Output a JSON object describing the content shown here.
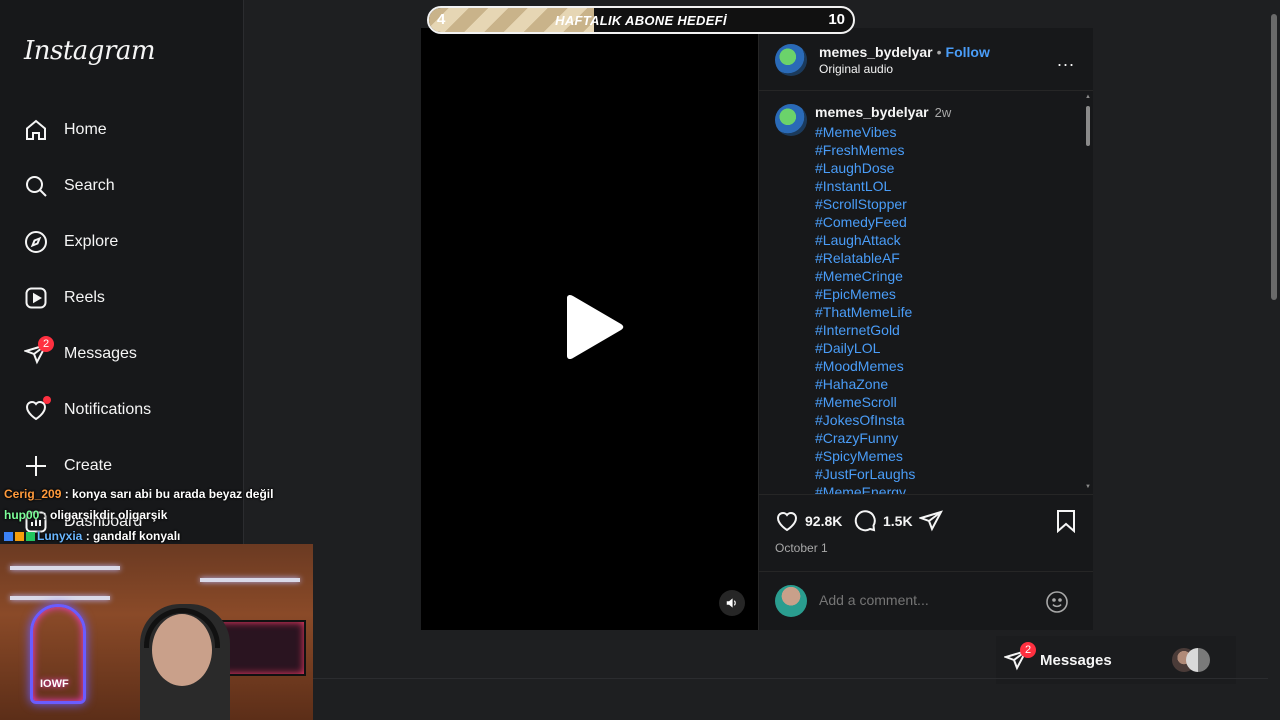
{
  "sidebar": {
    "logo": "Instagram",
    "items": [
      {
        "label": "Home",
        "icon": "home-icon"
      },
      {
        "label": "Search",
        "icon": "search-icon"
      },
      {
        "label": "Explore",
        "icon": "compass-icon"
      },
      {
        "label": "Reels",
        "icon": "reels-icon"
      },
      {
        "label": "Messages",
        "icon": "messenger-icon",
        "badge": "2"
      },
      {
        "label": "Notifications",
        "icon": "heart-icon"
      },
      {
        "label": "Create",
        "icon": "plus-icon"
      },
      {
        "label": "Dashboard",
        "icon": "dashboard-icon"
      }
    ]
  },
  "goal_bar": {
    "start": "4",
    "title": "HAFTALIK ABONE HEDEFİ",
    "end": "10",
    "progress": 0.39
  },
  "post": {
    "username": "memes_bydelyar",
    "separator": "•",
    "follow_label": "Follow",
    "audio": "Original audio",
    "more": "...",
    "caption": {
      "username": "memes_bydelyar",
      "time": "2w",
      "hashtags": [
        "#MemeVibes",
        "#FreshMemes",
        "#LaughDose",
        "#InstantLOL",
        "#ScrollStopper",
        "#ComedyFeed",
        "#LaughAttack",
        "#RelatableAF",
        "#MemeCringe",
        "#EpicMemes",
        "#ThatMemeLife",
        "#InternetGold",
        "#DailyLOL",
        "#MoodMemes",
        "#HahaZone",
        "#MemeScroll",
        "#JokesOfInsta",
        "#CrazyFunny",
        "#SpicyMemes",
        "#JustForLaughs",
        "#MemeEnergy"
      ]
    },
    "likes": "92.8K",
    "comments": "1.5K",
    "date": "October 1",
    "comment_placeholder": "Add a comment..."
  },
  "messages_pill": {
    "label": "Messages",
    "badge": "2"
  },
  "chat": [
    {
      "user": "Cerig_209",
      "message": "konya sarı abi bu arada beyaz değil"
    },
    {
      "user": "hup00",
      "message": "oligarşikdir oligarşik"
    },
    {
      "user": "Lunyxia",
      "message": "gandalf konyalı"
    }
  ],
  "webcam": {
    "neon_label": "IOWF"
  },
  "colors": {
    "accent_blue": "#4a9df8",
    "badge_red": "#ff3040",
    "background": "#1e1f21"
  }
}
